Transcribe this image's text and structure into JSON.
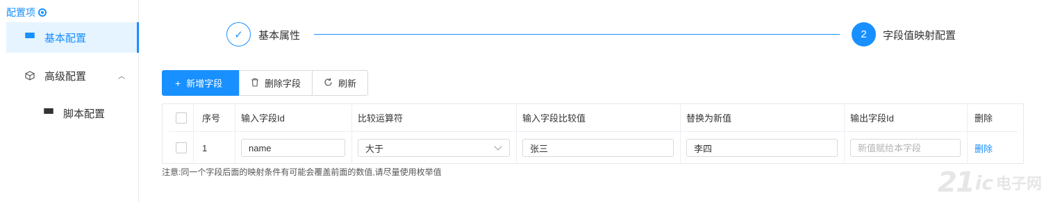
{
  "sidebar": {
    "title": "配置项",
    "items": [
      {
        "label": "基本配置",
        "icon": "grid-icon",
        "active": true
      },
      {
        "label": "高级配置",
        "icon": "cube-icon",
        "expanded": true
      },
      {
        "label": "脚本配置",
        "icon": "grid-icon",
        "sub": true
      }
    ]
  },
  "steps": [
    {
      "number": "✓",
      "label": "基本属性",
      "status": "finished"
    },
    {
      "number": "2",
      "label": "字段值映射配置",
      "status": "current"
    }
  ],
  "toolbar": {
    "add_label": "新增字段",
    "delete_label": "删除字段",
    "refresh_label": "刷新"
  },
  "table": {
    "headers": [
      "序号",
      "输入字段Id",
      "比较运算符",
      "输入字段比较值",
      "替换为新值",
      "输出字段Id",
      "删除"
    ],
    "rows": [
      {
        "index": "1",
        "input_field_id": "name",
        "operator": "大于",
        "compare_value": "张三",
        "new_value": "李四",
        "output_field_placeholder": "新值赋给本字段",
        "delete_label": "删除"
      }
    ]
  },
  "note": "注意:同一个字段后面的映射条件有可能会覆盖前面的数值,请尽量使用枚举值",
  "watermark": {
    "num": "21",
    "ic": "ic",
    "cn": "电子网"
  },
  "colors": {
    "accent": "#1890ff",
    "active_bg": "#e6f4ff"
  }
}
